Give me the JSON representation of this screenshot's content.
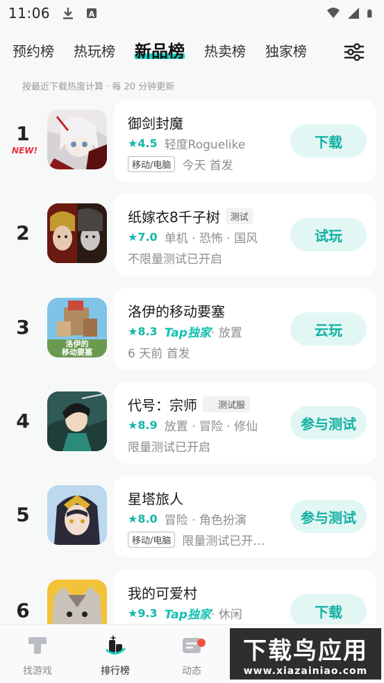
{
  "status_bar": {
    "time": "11:06",
    "icons": [
      "download-icon",
      "a-icon",
      "wifi-icon",
      "signal-icon",
      "battery-icon"
    ]
  },
  "tabs": [
    {
      "label": "预约榜",
      "active": false
    },
    {
      "label": "热玩榜",
      "active": false
    },
    {
      "label": "新品榜",
      "active": true
    },
    {
      "label": "热卖榜",
      "active": false
    },
    {
      "label": "独家榜",
      "active": false
    }
  ],
  "subtitle": "按最近下载热度计算 · 每 20 分钟更新",
  "games": [
    {
      "rank": "1",
      "new_tag": "NEW!",
      "title": "御剑封魔",
      "badge": "",
      "rating": "4.5",
      "meta": "轻度Roguelike",
      "tap": "",
      "platform": "移动/电脑",
      "info": "今天 首发",
      "action": "下载"
    },
    {
      "rank": "2",
      "new_tag": "",
      "title": "纸嫁衣8千子树",
      "badge": "测试",
      "rating": "7.0",
      "meta": "单机 · 恐怖 · 国风",
      "tap": "",
      "platform": "",
      "info": "不限量测试已开启",
      "action": "试玩"
    },
    {
      "rank": "3",
      "new_tag": "",
      "title": "洛伊的移动要塞",
      "badge": "",
      "rating": "8.3",
      "meta": " · 放置",
      "tap": "Tap独家",
      "platform": "",
      "info": "6 天前 首发",
      "action": "云玩"
    },
    {
      "rank": "4",
      "new_tag": "",
      "title": "代号：宗师",
      "badge": "测试服",
      "rating": "8.9",
      "meta": "放置 · 冒险 · 修仙",
      "tap": "",
      "platform": "",
      "info": "限量测试已开启",
      "action": "参与测试"
    },
    {
      "rank": "5",
      "new_tag": "",
      "title": "星塔旅人",
      "badge": "",
      "rating": "8.0",
      "meta": "冒险 · 角色扮演",
      "tap": "",
      "platform": "移动/电脑",
      "info": "限量测试已开…",
      "action": "参与测试"
    },
    {
      "rank": "6",
      "new_tag": "",
      "title": "我的可爱村",
      "badge": "",
      "rating": "9.3",
      "meta": " · 休闲",
      "tap": "Tap独家",
      "platform": "",
      "info": "",
      "action": "下载"
    }
  ],
  "bottom_nav": [
    {
      "label": "找游戏",
      "icon": "find-game-icon",
      "active": false
    },
    {
      "label": "排行榜",
      "icon": "ranking-icon",
      "active": true
    },
    {
      "label": "动态",
      "icon": "feed-icon",
      "active": false
    }
  ],
  "watermark": {
    "main": "下载鸟应用",
    "url": "www.xiazainiao.com"
  },
  "colors": {
    "accent": "#14d0c2",
    "button_bg": "#e2f7f4",
    "button_text": "#13b0a3",
    "new_tag": "#e8323c"
  }
}
